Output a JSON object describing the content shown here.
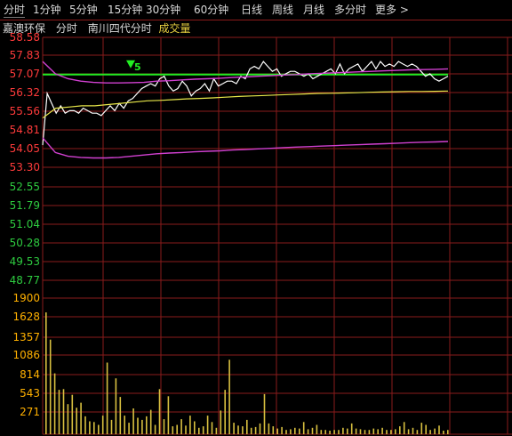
{
  "tabs": [
    {
      "label": "分时",
      "active": true
    },
    {
      "label": "1分钟",
      "active": false
    },
    {
      "label": "5分钟",
      "active": false
    },
    {
      "label": "15分钟",
      "active": false
    },
    {
      "label": "30分钟",
      "active": false
    },
    {
      "label": "60分钟",
      "active": false
    },
    {
      "label": "日线",
      "active": false
    },
    {
      "label": "周线",
      "active": false
    },
    {
      "label": "月线",
      "active": false
    },
    {
      "label": "多分时",
      "active": false
    },
    {
      "label": "更多 >",
      "active": false
    }
  ],
  "header": {
    "stock_name": "嘉澳环保",
    "chart_label": "分时",
    "overlay_label": "南川四代分时",
    "volume_label": "成交量"
  },
  "colors": {
    "price_axis": "#ff3b3b",
    "volume_axis": "#ffb000",
    "lower_axis": "#2ecc40",
    "grid": "#8a1b1b",
    "price": "#ffffff",
    "avg": "#e8e84a",
    "band": "#d040d0",
    "marker": "#22ee22",
    "volume": "#d8c040"
  },
  "chart_data": [
    {
      "type": "line",
      "y_ticks": [
        "58.58",
        "57.83",
        "57.07",
        "56.32",
        "55.56",
        "54.81",
        "54.05",
        "53.30"
      ],
      "ylim": [
        53.3,
        58.58
      ],
      "reference_level": 57.07,
      "marker_label": "5",
      "series": [
        {
          "key": "price",
          "values": [
            54.2,
            56.3,
            55.9,
            55.5,
            55.8,
            55.5,
            55.6,
            55.6,
            55.5,
            55.7,
            55.6,
            55.5,
            55.5,
            55.4,
            55.6,
            55.8,
            55.6,
            55.9,
            55.7,
            56.0,
            56.1,
            56.3,
            56.5,
            56.6,
            56.7,
            56.6,
            56.9,
            57.0,
            56.6,
            56.4,
            56.5,
            56.8,
            56.6,
            56.2,
            56.4,
            56.5,
            56.7,
            56.4,
            56.9,
            56.6,
            56.7,
            56.8,
            56.8,
            56.7,
            57.0,
            56.9,
            57.3,
            57.4,
            57.3,
            57.6,
            57.4,
            57.2,
            57.3,
            57.0,
            57.1,
            57.2,
            57.2,
            57.1,
            57.0,
            57.1,
            56.9,
            57.0,
            57.1,
            57.2,
            57.3,
            57.1,
            57.5,
            57.1,
            57.3,
            57.4,
            57.5,
            57.2,
            57.4,
            57.6,
            57.3,
            57.6,
            57.4,
            57.5,
            57.4,
            57.6,
            57.5,
            57.4,
            57.5,
            57.4,
            57.2,
            57.0,
            57.1,
            56.9,
            56.8,
            56.9,
            57.0
          ]
        },
        {
          "key": "avg",
          "values": [
            55.3,
            55.7,
            55.75,
            55.8,
            55.8,
            55.85,
            55.9,
            55.95,
            56.0,
            56.02,
            56.05,
            56.08,
            56.1,
            56.12,
            56.15,
            56.18,
            56.2,
            56.22,
            56.24,
            56.26,
            56.28,
            56.3,
            56.31,
            56.32,
            56.33,
            56.35,
            56.36,
            56.37,
            56.38,
            56.38,
            56.39,
            56.4
          ]
        },
        {
          "key": "upper_band",
          "values": [
            57.6,
            57.1,
            56.9,
            56.8,
            56.75,
            56.73,
            56.73,
            56.74,
            56.75,
            56.8,
            56.82,
            56.85,
            56.88,
            56.9,
            56.92,
            56.95,
            56.97,
            57.0,
            57.02,
            57.05,
            57.07,
            57.1,
            57.12,
            57.14,
            57.16,
            57.18,
            57.2,
            57.22,
            57.24,
            57.26,
            57.27,
            57.28,
            57.3
          ]
        },
        {
          "key": "lower_band",
          "values": [
            54.5,
            53.9,
            53.75,
            53.7,
            53.68,
            53.68,
            53.7,
            53.75,
            53.8,
            53.85,
            53.88,
            53.9,
            53.93,
            53.95,
            53.97,
            54.0,
            54.02,
            54.05,
            54.07,
            54.1,
            54.12,
            54.14,
            54.16,
            54.18,
            54.2,
            54.22,
            54.24,
            54.26,
            54.28,
            54.3,
            54.32,
            54.33,
            54.35
          ]
        }
      ]
    },
    {
      "type": "line",
      "y_ticks": [
        "52.55",
        "51.79",
        "51.04",
        "50.28",
        "49.53",
        "48.77"
      ]
    },
    {
      "type": "bar",
      "y_ticks": [
        "1900",
        "1628",
        "1357",
        "1086",
        "814",
        "543",
        "271"
      ],
      "ylim": [
        0,
        1900
      ],
      "values": [
        1700,
        1320,
        850,
        620,
        630,
        420,
        550,
        370,
        440,
        250,
        180,
        170,
        130,
        260,
        1000,
        200,
        780,
        520,
        260,
        160,
        360,
        230,
        200,
        250,
        340,
        130,
        630,
        210,
        530,
        110,
        130,
        210,
        120,
        260,
        180,
        90,
        110,
        260,
        170,
        90,
        330,
        620,
        1040,
        160,
        120,
        110,
        200,
        90,
        100,
        150,
        560,
        150,
        110,
        80,
        100,
        60,
        70,
        90,
        80,
        170,
        70,
        90,
        130,
        60,
        60,
        50,
        60,
        60,
        90,
        80,
        150,
        80,
        70,
        60,
        60,
        80,
        70,
        90,
        60,
        60,
        70,
        110,
        170,
        70,
        90,
        60,
        160,
        130,
        60,
        80,
        120,
        50,
        60
      ]
    }
  ]
}
